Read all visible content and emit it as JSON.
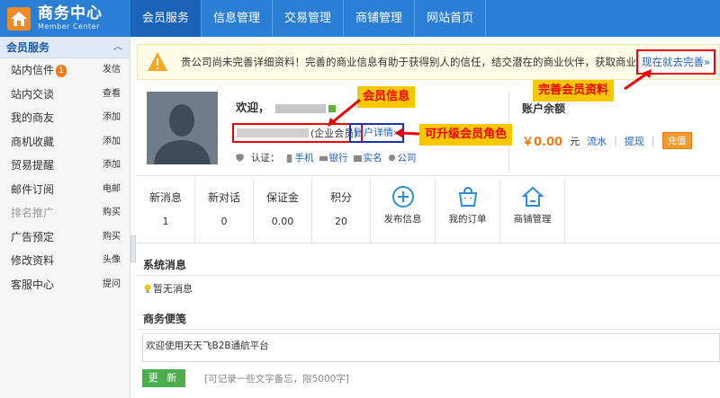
{
  "header": {
    "title": "商务中心",
    "subtitle": "Member Center",
    "nav": [
      "会员服务",
      "信息管理",
      "交易管理",
      "商铺管理",
      "网站首页"
    ]
  },
  "sidebar": {
    "section": "会员服务",
    "items": [
      {
        "label": "站内信件",
        "badge": "1",
        "action": "发信"
      },
      {
        "label": "站内交谈",
        "action": "查看"
      },
      {
        "label": "我的商友",
        "action": "添加"
      },
      {
        "label": "商机收藏",
        "action": "添加"
      },
      {
        "label": "贸易提醒",
        "action": "添加"
      },
      {
        "label": "邮件订阅",
        "action": "电邮"
      },
      {
        "label": "排名推广",
        "action": "购买"
      },
      {
        "label": "广告预定",
        "action": "购买"
      },
      {
        "label": "修改资料",
        "action": "头像"
      },
      {
        "label": "客服中心",
        "action": "提问"
      }
    ]
  },
  "notice": {
    "text": "贵公司尚未完善详细资料！完善的商业信息有助于获得别人的信任，结交潜在的商业伙伴，获取商业机会",
    "link": "现在就去完善»"
  },
  "profile": {
    "welcome": "欢迎，",
    "member_type": "(企业会员)",
    "account_link": "账户详情»",
    "cert_label": "认证：",
    "certs": [
      "手机",
      "银行",
      "实名",
      "公司"
    ]
  },
  "balance": {
    "title": "账户余额",
    "amount": "￥0.00",
    "unit": "元",
    "flow": "流水",
    "withdraw": "提现",
    "recharge": "充值"
  },
  "annotations": {
    "member_info": "会员信息",
    "upgrade": "可升级会员角色",
    "complete": "完善会员资料"
  },
  "stats": [
    {
      "label": "新消息",
      "value": "1"
    },
    {
      "label": "新对话",
      "value": "0"
    },
    {
      "label": "保证金",
      "value": "0.00"
    },
    {
      "label": "积分",
      "value": "20"
    }
  ],
  "quick_actions": [
    "发布信息",
    "我的订单",
    "商铺管理"
  ],
  "system": {
    "title": "系统消息",
    "empty": "暂无消息"
  },
  "memo": {
    "title": "商务便笺",
    "content": "欢迎使用天天飞B2B通航平台",
    "button": "更 新",
    "hint": "[可记录一些文字备忘，限5000字]"
  }
}
